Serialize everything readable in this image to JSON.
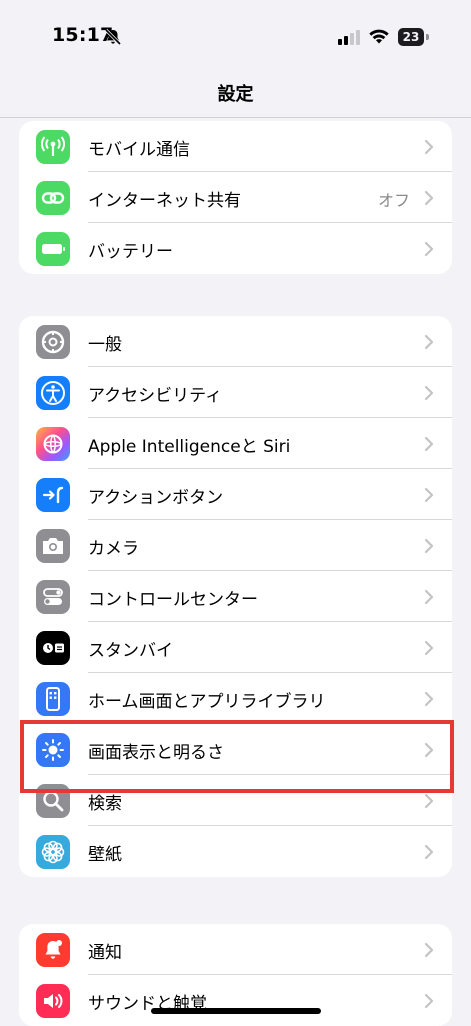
{
  "status_bar": {
    "time": "15:17",
    "battery": "23"
  },
  "nav": {
    "title": "設定"
  },
  "groups": [
    {
      "rows": [
        {
          "label": "モバイル通信",
          "icon": "antenna-icon",
          "color": "#4cd964"
        },
        {
          "label": "インターネット共有",
          "value": "オフ",
          "icon": "link-icon",
          "color": "#4cd964"
        },
        {
          "label": "バッテリー",
          "icon": "battery-icon",
          "color": "#4cd964"
        }
      ]
    },
    {
      "rows": [
        {
          "label": "一般",
          "icon": "gear-icon",
          "color": "#8e8e93"
        },
        {
          "label": "アクセシビリティ",
          "icon": "accessibility-icon",
          "color": "#147efb"
        },
        {
          "label": "Apple Intelligenceと Siri",
          "icon": "apple-intelligence-icon",
          "color": "#f0a"
        },
        {
          "label": "アクションボタン",
          "icon": "action-button-icon",
          "color": "#147efb"
        },
        {
          "label": "カメラ",
          "icon": "camera-icon",
          "color": "#8e8e93"
        },
        {
          "label": "コントロールセンター",
          "icon": "control-center-icon",
          "color": "#8e8e93"
        },
        {
          "label": "スタンバイ",
          "icon": "standby-icon",
          "color": "#000000"
        },
        {
          "label": "ホーム画面とアプリライブラリ",
          "icon": "home-screen-icon",
          "color": "#3478f6"
        },
        {
          "label": "画面表示と明るさ",
          "icon": "brightness-icon",
          "color": "#3478f6"
        },
        {
          "label": "検索",
          "icon": "search-icon",
          "color": "#8e8e93"
        },
        {
          "label": "壁紙",
          "icon": "wallpaper-icon",
          "color": "#35aadc"
        }
      ]
    },
    {
      "rows": [
        {
          "label": "通知",
          "icon": "notification-icon",
          "color": "#ff3b30"
        },
        {
          "label": "サウンドと触覚",
          "icon": "sound-icon",
          "color": "#ff2d55"
        }
      ]
    }
  ],
  "highlight_color": "#e53935"
}
